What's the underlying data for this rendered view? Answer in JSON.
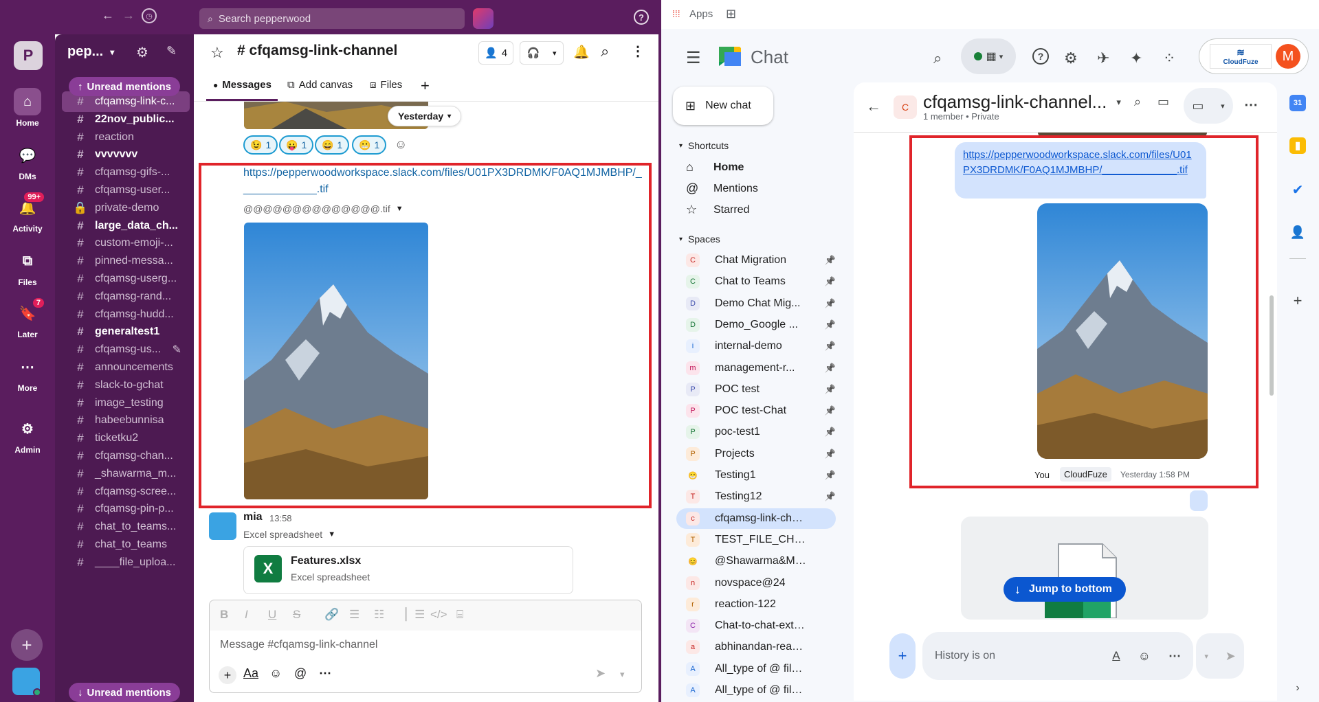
{
  "slack": {
    "search_placeholder": "Search pepperwood",
    "workspace_initial": "P",
    "workspace_name": "pep...",
    "rail": [
      {
        "label": "Home",
        "icon": "home-icon"
      },
      {
        "label": "DMs",
        "icon": "chat-bubbles-icon"
      },
      {
        "label": "Activity",
        "icon": "bell-icon",
        "badge": "99+"
      },
      {
        "label": "Files",
        "icon": "files-icon"
      },
      {
        "label": "Later",
        "icon": "bookmark-icon",
        "badge": "7"
      },
      {
        "label": "More",
        "icon": "more-dots-icon"
      },
      {
        "label": "Admin",
        "icon": "gear-icon"
      }
    ],
    "unread_top": "Unread mentions",
    "unread_bottom": "Unread mentions",
    "channels": [
      {
        "name": "cfqamsg-link-c...",
        "bold": false,
        "active": true,
        "icon": "#"
      },
      {
        "name": "22nov_public...",
        "bold": true,
        "icon": "#"
      },
      {
        "name": "reaction",
        "bold": false,
        "icon": "#"
      },
      {
        "name": "vvvvvvv",
        "bold": true,
        "icon": "#"
      },
      {
        "name": "cfqamsg-gifs-...",
        "bold": false,
        "icon": "#"
      },
      {
        "name": "cfqamsg-user...",
        "bold": false,
        "icon": "#"
      },
      {
        "name": "private-demo",
        "bold": false,
        "icon": "lock"
      },
      {
        "name": "large_data_ch...",
        "bold": true,
        "icon": "#"
      },
      {
        "name": "custom-emoji-...",
        "bold": false,
        "icon": "#"
      },
      {
        "name": "pinned-messa...",
        "bold": false,
        "icon": "#"
      },
      {
        "name": "cfqamsg-userg...",
        "bold": false,
        "icon": "#"
      },
      {
        "name": "cfqamsg-rand...",
        "bold": false,
        "icon": "#"
      },
      {
        "name": "cfqamsg-hudd...",
        "bold": false,
        "icon": "#"
      },
      {
        "name": "generaltest1",
        "bold": true,
        "icon": "#"
      },
      {
        "name": "cfqamsg-us...",
        "bold": false,
        "icon": "#",
        "edit": true
      },
      {
        "name": "announcements",
        "bold": false,
        "icon": "#"
      },
      {
        "name": "slack-to-gchat",
        "bold": false,
        "icon": "#"
      },
      {
        "name": "image_testing",
        "bold": false,
        "icon": "#"
      },
      {
        "name": "habeebunnisa",
        "bold": false,
        "icon": "#"
      },
      {
        "name": "ticketku2",
        "bold": false,
        "icon": "#"
      },
      {
        "name": "cfqamsg-chan...",
        "bold": false,
        "icon": "#"
      },
      {
        "name": "_shawarma_m...",
        "bold": false,
        "icon": "#"
      },
      {
        "name": "cfqamsg-scree...",
        "bold": false,
        "icon": "#"
      },
      {
        "name": "cfqamsg-pin-p...",
        "bold": false,
        "icon": "#"
      },
      {
        "name": "chat_to_teams...",
        "bold": false,
        "icon": "#"
      },
      {
        "name": "chat_to_teams",
        "bold": false,
        "icon": "#"
      },
      {
        "name": "____file_uploa...",
        "bold": false,
        "icon": "#"
      }
    ],
    "channel_title": "# cfqamsg-link-channel",
    "member_count": "4",
    "tabs": {
      "messages": "Messages",
      "canvas": "Add canvas",
      "files": "Files"
    },
    "date_divider": "Yesterday",
    "reactions": [
      {
        "emoji": "😉",
        "count": "1"
      },
      {
        "emoji": "😛",
        "count": "1"
      },
      {
        "emoji": "😄",
        "count": "1"
      },
      {
        "emoji": "😬",
        "count": "1"
      }
    ],
    "link": "https://pepperwoodworkspace.slack.com/files/U01PX3DRDMK/F0AQ1MJMBHP/_____________.tif",
    "file_name": "@@@@@@@@@@@@@@.tif",
    "msg2": {
      "author": "mia",
      "time": "13:58",
      "sub": "Excel spreadsheet",
      "file": "Features.xlsx",
      "file_sub": "Excel spreadsheet",
      "file_icon": "X"
    },
    "composer_placeholder": "Message #cfqamsg-link-channel"
  },
  "gchat": {
    "bookmark_apps": "Apps",
    "app_title": "Chat",
    "new_chat": "New chat",
    "shortcuts_label": "Shortcuts",
    "shortcuts": [
      {
        "label": "Home",
        "icon": "home-icon",
        "bold": true
      },
      {
        "label": "Mentions",
        "icon": "at-icon"
      },
      {
        "label": "Starred",
        "icon": "star-icon"
      }
    ],
    "spaces_label": "Spaces",
    "spaces": [
      {
        "name": "Chat Migration",
        "initial": "C",
        "bg": "#fce8e6",
        "fg": "#c5221f",
        "pin": true
      },
      {
        "name": "Chat to Teams",
        "initial": "C",
        "bg": "#e6f4ea",
        "fg": "#137333",
        "pin": true
      },
      {
        "name": "Demo Chat Mig...",
        "initial": "D",
        "bg": "#e8eaf6",
        "fg": "#3949ab",
        "pin": true
      },
      {
        "name": "Demo_Google ...",
        "initial": "D",
        "bg": "#e6f4ea",
        "fg": "#137333",
        "pin": true
      },
      {
        "name": "internal-demo",
        "initial": "i",
        "bg": "#e8f0fe",
        "fg": "#1967d2",
        "pin": true
      },
      {
        "name": "management-r...",
        "initial": "m",
        "bg": "#fce4ec",
        "fg": "#c2185b",
        "pin": true
      },
      {
        "name": "POC test",
        "initial": "P",
        "bg": "#e8eaf6",
        "fg": "#3949ab",
        "pin": true
      },
      {
        "name": "POC test-Chat",
        "initial": "P",
        "bg": "#fce4ec",
        "fg": "#c2185b",
        "pin": true
      },
      {
        "name": "poc-test1",
        "initial": "P",
        "bg": "#e6f4ea",
        "fg": "#137333",
        "pin": true
      },
      {
        "name": "Projects",
        "initial": "P",
        "bg": "#fdebd9",
        "fg": "#b06000",
        "pin": true
      },
      {
        "name": "Testing1",
        "initial": "😁",
        "bg": "transparent",
        "fg": "#000",
        "pin": true
      },
      {
        "name": "Testing12",
        "initial": "T",
        "bg": "#fce8e6",
        "fg": "#c5221f",
        "pin": true
      },
      {
        "name": "cfqamsg-link-chan...",
        "initial": "c",
        "bg": "#fce8e6",
        "fg": "#c5221f",
        "active": true
      },
      {
        "name": "TEST_FILE_CHAT_T...",
        "initial": "T",
        "bg": "#fdebd9",
        "fg": "#b06000"
      },
      {
        "name": "@Shawarma&Momos",
        "initial": "😊",
        "bg": "transparent",
        "fg": "#000"
      },
      {
        "name": "novspace@24",
        "initial": "n",
        "bg": "#fce8e6",
        "fg": "#c5221f"
      },
      {
        "name": "reaction-122",
        "initial": "r",
        "bg": "#fdebd9",
        "fg": "#b06000"
      },
      {
        "name": "Chat-to-chat-exter...",
        "initial": "C",
        "bg": "#f3e5f5",
        "fg": "#8e24aa"
      },
      {
        "name": "abhinandan-reactio...",
        "initial": "a",
        "bg": "#fce8e6",
        "fg": "#c5221f"
      },
      {
        "name": "All_type of @ files-r...",
        "initial": "A",
        "bg": "#e8f0fe",
        "fg": "#1967d2"
      },
      {
        "name": "All_type of @ files-...",
        "initial": "A",
        "bg": "#e8f0fe",
        "fg": "#1967d2"
      }
    ],
    "channel_title": "cfqamsg-link-channel...",
    "channel_initial": "C",
    "channel_meta": "1 member  •  Private",
    "bubble_link": "https://pepperwoodworkspace.slack.com/files/U01PX3DRDMK/F0AQ1MJMBHP/_____________.tif",
    "sender_you": "You",
    "sender_via": "CloudFuze",
    "msg_time": "Yesterday 1:58 PM",
    "jump_label": "Jump to bottom",
    "input_placeholder": "History is on",
    "account_initial": "M",
    "account_logo_text": "CloudFuze"
  }
}
